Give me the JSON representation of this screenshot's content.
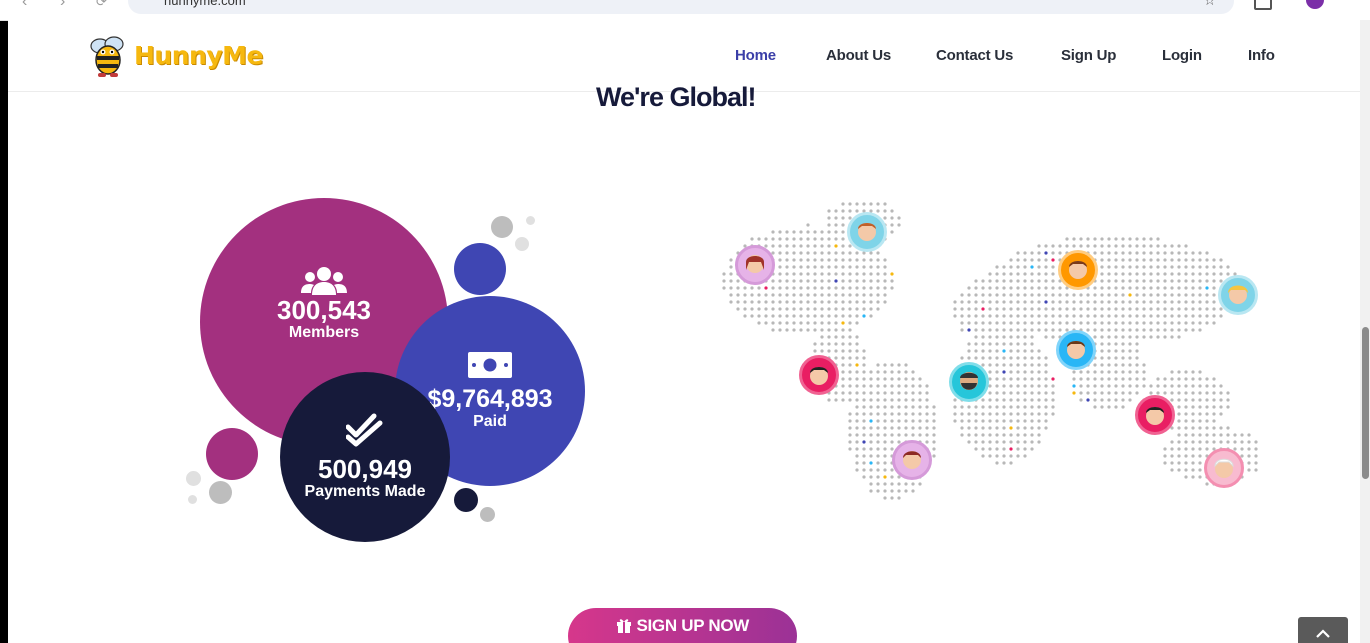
{
  "browser": {
    "url": "hunnyme.com"
  },
  "brand": {
    "name": "HunnyMe",
    "colors": {
      "logo": "#f6b80f",
      "nav_active": "#3b3fa8",
      "members": "#a3307f",
      "paid": "#3f46b3",
      "payments": "#161a3a",
      "cta_start": "#d6378b",
      "cta_end": "#9b3296"
    }
  },
  "nav": {
    "items": [
      {
        "label": "Home",
        "active": true
      },
      {
        "label": "About Us"
      },
      {
        "label": "Contact Us"
      },
      {
        "label": "Sign Up"
      },
      {
        "label": "Login"
      },
      {
        "label": "Info"
      }
    ]
  },
  "section": {
    "title": "We're Global!"
  },
  "stats": {
    "members": {
      "value": "300,543",
      "label": "Members",
      "icon": "users-icon"
    },
    "paid": {
      "value": "$9,764,893",
      "label": "Paid",
      "icon": "money-icon"
    },
    "payments": {
      "value": "500,949",
      "label": "Payments Made",
      "icon": "double-check-icon"
    }
  },
  "cta": {
    "label": "SIGN UP NOW",
    "icon": "gift-icon"
  },
  "back_to_top": {
    "icon": "chevron-up-icon"
  }
}
